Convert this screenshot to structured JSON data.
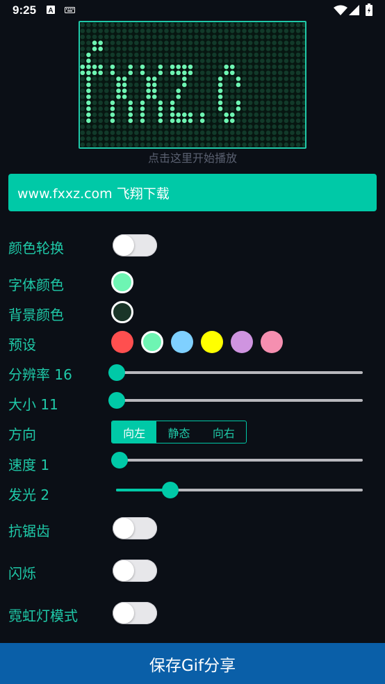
{
  "status_bar": {
    "time": "9:25",
    "left_icons": [
      "a-notification-icon",
      "keyboard-icon"
    ],
    "right_icons": [
      "wifi-icon",
      "signal-icon",
      "battery-icon"
    ]
  },
  "display": {
    "preview_text": "fxxz.c",
    "led_color": "#6ef5b3",
    "led_off_color": "#123a2a",
    "hint": "点击这里开始播放"
  },
  "text_input": {
    "value": "www.fxxz.com 飞翔下载"
  },
  "color_cycle": {
    "label": "颜色轮换",
    "on": false
  },
  "font_color": {
    "label": "字体颜色",
    "value": "#6ef5b3"
  },
  "bg_color": {
    "label": "背景颜色",
    "value": "#1a3528"
  },
  "presets": {
    "label": "预设",
    "colors": [
      "#ff4f4f",
      "#6ef5b3",
      "#7fd0ff",
      "#ffff00",
      "#cf94e0",
      "#f58fb0"
    ],
    "selected_index": 1
  },
  "resolution": {
    "label": "分辨率 16",
    "value_fraction": 0.0
  },
  "size": {
    "label": "大小 11",
    "value_fraction": 0.0
  },
  "direction": {
    "label": "方向",
    "options": [
      "向左",
      "静态",
      "向右"
    ],
    "selected_index": 0
  },
  "speed": {
    "label": "速度 1",
    "value_fraction": 0.0
  },
  "glow": {
    "label": "发光 2",
    "value_fraction": 0.2
  },
  "antialias": {
    "label": "抗锯齿",
    "on": false
  },
  "blink": {
    "label": "闪烁",
    "on": false
  },
  "neon": {
    "label": "霓虹灯模式",
    "on": false
  },
  "save_button": {
    "label": "保存Gif分享"
  },
  "colors": {
    "accent": "#00c9a7",
    "background": "#0b0f16",
    "save_bar": "#0a5fa8"
  }
}
